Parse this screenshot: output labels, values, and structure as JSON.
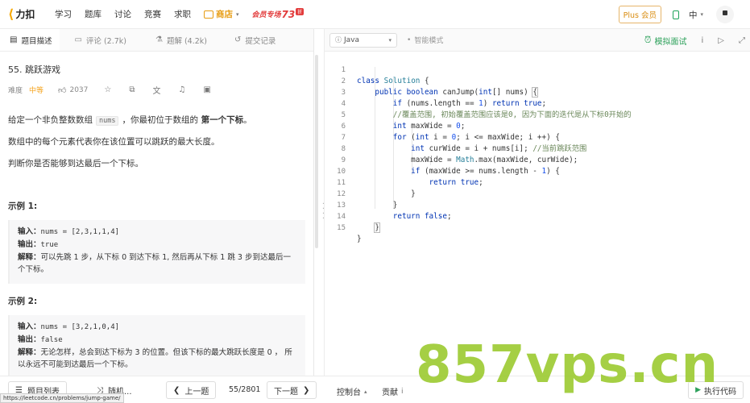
{
  "nav": {
    "logo_text": "力扣",
    "links": [
      "学习",
      "题库",
      "讨论",
      "竞赛",
      "求职"
    ],
    "shop_label": "商店",
    "promo": {
      "part1": "会员专场",
      "part2": "73",
      "part3": "折"
    },
    "plus_label": "Plus 会员",
    "lang_label": "中"
  },
  "tabs": [
    {
      "label": "题目描述",
      "icon": "description-icon"
    },
    {
      "label": "评论 (2.7k)",
      "icon": "comment-icon"
    },
    {
      "label": "题解 (4.2k)",
      "icon": "solution-icon"
    },
    {
      "label": "提交记录",
      "icon": "history-icon"
    }
  ],
  "problem": {
    "title": "55. 跳跃游戏",
    "difficulty_label": "难度",
    "difficulty": "中等",
    "likes": "2037",
    "para1_pre": "给定一个非负整数数组",
    "para1_code": "nums",
    "para1_mid": "，你最初位于数组的",
    "para1_bold": "第一个下标",
    "para1_end": "。",
    "para2": "数组中的每个元素代表你在该位置可以跳跃的最大长度。",
    "para3": "判断你是否能够到达最后一个下标。",
    "examples": [
      {
        "title": "示例 1:",
        "input_label": "输入：",
        "input": "nums = [2,3,1,1,4]",
        "output_label": "输出：",
        "output": "true",
        "explain_label": "解释：",
        "explain": "可以先跳 1 步，从下标 0 到达下标 1, 然后再从下标 1 跳 3 步到达最后一个下标。"
      },
      {
        "title": "示例 2:",
        "input_label": "输入：",
        "input": "nums = [3,2,1,0,4]",
        "output_label": "输出：",
        "output": "false",
        "explain_label": "解释：",
        "explain": "无论怎样，总会到达下标为 3 的位置。但该下标的最大跳跃长度是 0 ， 所以永远不可能到达最后一个下标。"
      }
    ]
  },
  "editor": {
    "language": "Java",
    "mode": "智能模式",
    "mock_label": "模拟面试",
    "code_lines": [
      "class Solution {",
      "    public boolean canJump(int[] nums) {",
      "        if (nums.length == 1) return true;",
      "        //覆盖范围, 初始覆盖范围应该是0, 因为下面的迭代是从下标0开始的",
      "        int maxWide = 0;",
      "        for (int i = 0; i <= maxWide; i ++) {",
      "            int curWide = i + nums[i]; //当前跳跃范围",
      "            maxWide = Math.max(maxWide, curWide);",
      "            if (maxWide >= nums.length - 1) {",
      "                return true;",
      "            }",
      "        }",
      "        return false;",
      "    }",
      "}"
    ]
  },
  "bottom": {
    "problem_list": "题目列表",
    "random": "随机...",
    "prev": "上一题",
    "page": "55/2801",
    "next": "下一题",
    "console": "控制台",
    "contribute": "贡献",
    "run": "执行代码",
    "url_tip": "https://leetcode.cn/problems/jump-game/"
  },
  "watermark": "857vps.cn",
  "colors": {
    "brand": "#f7a800",
    "accent_green": "#2da15b",
    "difficulty_medium": "#f5a623",
    "watermark": "#98c82a"
  }
}
